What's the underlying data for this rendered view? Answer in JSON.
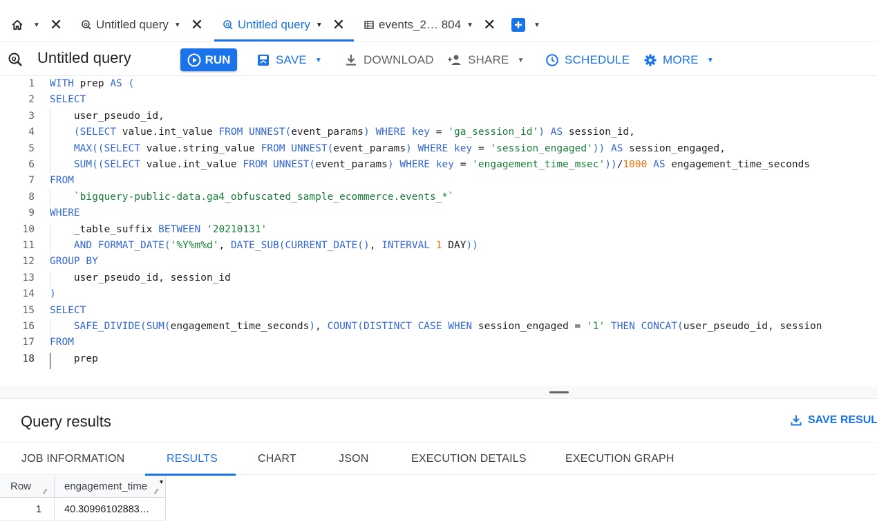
{
  "tabs": [
    {
      "label": "Untitled query",
      "icon": "query-icon"
    },
    {
      "label": "Untitled query",
      "icon": "query-icon",
      "active": true
    },
    {
      "label": "events_2… 804",
      "icon": "table-icon"
    }
  ],
  "toolbar": {
    "title": "Untitled query",
    "run_label": "RUN",
    "save_label": "SAVE",
    "download_label": "DOWNLOAD",
    "share_label": "SHARE",
    "schedule_label": "SCHEDULE",
    "more_label": "MORE"
  },
  "editor": {
    "lines": [
      {
        "n": "1",
        "parts": [
          [
            "kw",
            "WITH"
          ],
          [
            "t",
            " prep "
          ],
          [
            "kw",
            "AS"
          ],
          [
            "t",
            " "
          ],
          [
            "kw",
            "("
          ]
        ]
      },
      {
        "n": "2",
        "parts": [
          [
            "kw",
            "SELECT"
          ]
        ]
      },
      {
        "n": "3",
        "indent": true,
        "parts": [
          [
            "t",
            "    user_pseudo_id,"
          ]
        ]
      },
      {
        "n": "4",
        "indent": true,
        "parts": [
          [
            "t",
            "    "
          ],
          [
            "kw",
            "(SELECT"
          ],
          [
            "t",
            " value.int_value "
          ],
          [
            "kw",
            "FROM"
          ],
          [
            "t",
            " "
          ],
          [
            "kw",
            "UNNEST("
          ],
          [
            "t",
            "event_params"
          ],
          [
            "kw",
            ")"
          ],
          [
            "t",
            " "
          ],
          [
            "kw",
            "WHERE"
          ],
          [
            "t",
            " "
          ],
          [
            "kw",
            "key"
          ],
          [
            "t",
            " = "
          ],
          [
            "str",
            "'ga_session_id'"
          ],
          [
            "kw",
            ")"
          ],
          [
            "t",
            " "
          ],
          [
            "kw",
            "AS"
          ],
          [
            "t",
            " session_id,"
          ]
        ]
      },
      {
        "n": "5",
        "indent": true,
        "parts": [
          [
            "t",
            "    "
          ],
          [
            "kw",
            "MAX(("
          ],
          [
            "kw",
            "SELECT"
          ],
          [
            "t",
            " value.string_value "
          ],
          [
            "kw",
            "FROM"
          ],
          [
            "t",
            " "
          ],
          [
            "kw",
            "UNNEST("
          ],
          [
            "t",
            "event_params"
          ],
          [
            "kw",
            ")"
          ],
          [
            "t",
            " "
          ],
          [
            "kw",
            "WHERE"
          ],
          [
            "t",
            " "
          ],
          [
            "kw",
            "key"
          ],
          [
            "t",
            " = "
          ],
          [
            "str",
            "'session_engaged'"
          ],
          [
            "kw",
            "))"
          ],
          [
            "t",
            " "
          ],
          [
            "kw",
            "AS"
          ],
          [
            "t",
            " session_engaged,"
          ]
        ]
      },
      {
        "n": "6",
        "indent": true,
        "parts": [
          [
            "t",
            "    "
          ],
          [
            "kw",
            "SUM(("
          ],
          [
            "kw",
            "SELECT"
          ],
          [
            "t",
            " value.int_value "
          ],
          [
            "kw",
            "FROM"
          ],
          [
            "t",
            " "
          ],
          [
            "kw",
            "UNNEST("
          ],
          [
            "t",
            "event_params"
          ],
          [
            "kw",
            ")"
          ],
          [
            "t",
            " "
          ],
          [
            "kw",
            "WHERE"
          ],
          [
            "t",
            " "
          ],
          [
            "kw",
            "key"
          ],
          [
            "t",
            " = "
          ],
          [
            "str",
            "'engagement_time_msec'"
          ],
          [
            "kw",
            "))"
          ],
          [
            "t",
            "/"
          ],
          [
            "num",
            "1000"
          ],
          [
            "t",
            " "
          ],
          [
            "kw",
            "AS"
          ],
          [
            "t",
            " engagement_time_seconds"
          ]
        ]
      },
      {
        "n": "7",
        "parts": [
          [
            "kw",
            "FROM"
          ]
        ]
      },
      {
        "n": "8",
        "indent": true,
        "parts": [
          [
            "t",
            "    "
          ],
          [
            "str",
            "`bigquery-public-data.ga4_obfuscated_sample_ecommerce.events_*`"
          ]
        ]
      },
      {
        "n": "9",
        "parts": [
          [
            "kw",
            "WHERE"
          ]
        ]
      },
      {
        "n": "10",
        "indent": true,
        "parts": [
          [
            "t",
            "    _table_suffix "
          ],
          [
            "kw",
            "BETWEEN"
          ],
          [
            "t",
            " "
          ],
          [
            "str",
            "'20210131'"
          ]
        ]
      },
      {
        "n": "11",
        "indent": true,
        "parts": [
          [
            "t",
            "    "
          ],
          [
            "kw",
            "AND"
          ],
          [
            "t",
            " "
          ],
          [
            "kw",
            "FORMAT_DATE("
          ],
          [
            "str",
            "'%Y%m%d'"
          ],
          [
            "t",
            ", "
          ],
          [
            "kw",
            "DATE_SUB("
          ],
          [
            "kw",
            "CURRENT_DATE()"
          ],
          [
            "t",
            ", "
          ],
          [
            "kw",
            "INTERVAL"
          ],
          [
            "t",
            " "
          ],
          [
            "num",
            "1"
          ],
          [
            "t",
            " DAY"
          ],
          [
            "kw",
            "))"
          ]
        ]
      },
      {
        "n": "12",
        "parts": [
          [
            "kw",
            "GROUP BY"
          ]
        ]
      },
      {
        "n": "13",
        "indent": true,
        "parts": [
          [
            "t",
            "    user_pseudo_id, session_id"
          ]
        ]
      },
      {
        "n": "14",
        "parts": [
          [
            "kw",
            ")"
          ]
        ]
      },
      {
        "n": "15",
        "parts": [
          [
            "kw",
            "SELECT"
          ]
        ]
      },
      {
        "n": "16",
        "indent": true,
        "parts": [
          [
            "t",
            "    "
          ],
          [
            "kw",
            "SAFE_DIVIDE("
          ],
          [
            "kw",
            "SUM("
          ],
          [
            "t",
            "engagement_time_seconds"
          ],
          [
            "kw",
            ")"
          ],
          [
            "t",
            ", "
          ],
          [
            "kw",
            "COUNT("
          ],
          [
            "kw",
            "DISTINCT"
          ],
          [
            "t",
            " "
          ],
          [
            "kw",
            "CASE"
          ],
          [
            "t",
            " "
          ],
          [
            "kw",
            "WHEN"
          ],
          [
            "t",
            " session_engaged = "
          ],
          [
            "str",
            "'1'"
          ],
          [
            "t",
            " "
          ],
          [
            "kw",
            "THEN"
          ],
          [
            "t",
            " "
          ],
          [
            "kw",
            "CONCAT("
          ],
          [
            "t",
            "user_pseudo_id, session"
          ]
        ]
      },
      {
        "n": "17",
        "parts": [
          [
            "kw",
            "FROM"
          ]
        ]
      },
      {
        "n": "18",
        "indent": true,
        "current": true,
        "parts": [
          [
            "t",
            "    prep"
          ]
        ]
      }
    ]
  },
  "results": {
    "title": "Query results",
    "save_results_label": "SAVE RESULT",
    "tabs": [
      "JOB INFORMATION",
      "RESULTS",
      "CHART",
      "JSON",
      "EXECUTION DETAILS",
      "EXECUTION GRAPH"
    ],
    "active_tab": "RESULTS",
    "columns": [
      "Row",
      "engagement_time"
    ],
    "rows": [
      [
        "1",
        "40.30996102883…"
      ]
    ]
  },
  "colors": {
    "accent": "#1a73e8",
    "keyword": "#3367d6",
    "string": "#188038",
    "number": "#e8710a"
  }
}
